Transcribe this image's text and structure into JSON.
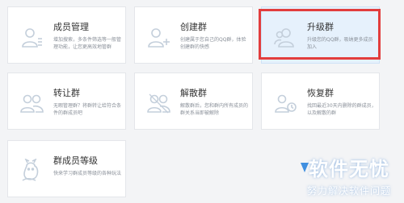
{
  "cards": [
    {
      "title": "成员管理",
      "desc": "增加搜索，多条件筛选等一般管理功能，让您更高效地管群",
      "icon": "member-manage-icon"
    },
    {
      "title": "创建群",
      "desc": "创建属于您自己的QQ群，体验创建群的快感",
      "icon": "create-group-icon"
    },
    {
      "title": "升级群",
      "desc": "升级您的QQ群，吸纳更多成员加入",
      "icon": "upgrade-group-icon"
    },
    {
      "title": "转让群",
      "desc": "无暇管理群？将群转让给符合条件的群成员吧",
      "icon": "transfer-group-icon"
    },
    {
      "title": "解散群",
      "desc": "解散群后，您和群内所有成员的群关系当即被解除",
      "icon": "dissolve-group-icon"
    },
    {
      "title": "恢复群",
      "desc": "找回最近30天内删除的群成员，以及解散的群",
      "icon": "restore-group-icon"
    },
    {
      "title": "群成员等级",
      "desc": "快来学习群成员等级的各种玩法",
      "icon": "member-level-icon"
    }
  ],
  "watermark": {
    "main": "软件无忧",
    "sub": "努力解决软件问题"
  },
  "colors": {
    "highlight_border": "#e23d3d",
    "highlight_bg": "#e6f1fc",
    "icon_stroke": "#c4cfdb",
    "title": "#333333",
    "desc": "#8a9099"
  }
}
